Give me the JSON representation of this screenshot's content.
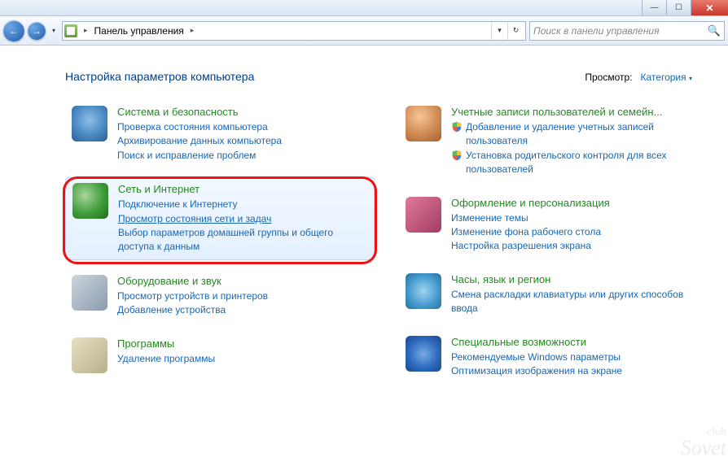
{
  "window": {
    "min": "—",
    "max": "☐",
    "close": "✕"
  },
  "nav": {
    "back": "←",
    "fwd": "→",
    "drop": "▾",
    "crumb": "Панель управления",
    "sep": "▸",
    "refresh": "↻",
    "addr_drop": "▾"
  },
  "search": {
    "placeholder": "Поиск в панели управления",
    "icon": "🔍"
  },
  "header": {
    "title": "Настройка параметров компьютера",
    "view_label": "Просмотр:",
    "view_value": "Категория",
    "view_arrow": "▾"
  },
  "cats_left": [
    {
      "id": "system",
      "title": "Система и безопасность",
      "links": [
        "Проверка состояния компьютера",
        "Архивирование данных компьютера",
        "Поиск и исправление проблем"
      ]
    },
    {
      "id": "network",
      "title": "Сеть и Интернет",
      "highlighted": true,
      "links": [
        "Подключение к Интернету",
        "Просмотр состояния сети и задач",
        "Выбор параметров домашней группы и общего доступа к данным"
      ],
      "underline_idx": 1
    },
    {
      "id": "hardware",
      "title": "Оборудование и звук",
      "links": [
        "Просмотр устройств и принтеров",
        "Добавление устройства"
      ]
    },
    {
      "id": "programs",
      "title": "Программы",
      "links": [
        "Удаление программы"
      ]
    }
  ],
  "cats_right": [
    {
      "id": "users",
      "title": "Учетные записи пользователей и семейн...",
      "links": [
        "Добавление и удаление учетных записей пользователя",
        "Установка родительского контроля для всех пользователей"
      ],
      "shielded": true
    },
    {
      "id": "appearance",
      "title": "Оформление и персонализация",
      "links": [
        "Изменение темы",
        "Изменение фона рабочего стола",
        "Настройка разрешения экрана"
      ]
    },
    {
      "id": "clock",
      "title": "Часы, язык и регион",
      "links": [
        "Смена раскладки клавиатуры или других способов ввода"
      ]
    },
    {
      "id": "access",
      "title": "Специальные возможности",
      "links": [
        "Рекомендуемые Windows параметры",
        "Оптимизация изображения на экране"
      ]
    }
  ],
  "watermark": {
    "line1": "club",
    "line2": "Sovet"
  }
}
